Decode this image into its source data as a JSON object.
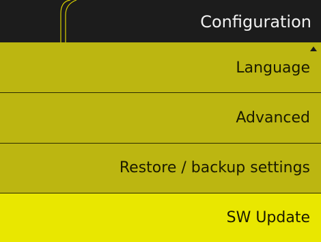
{
  "header": {
    "title": "Configuration"
  },
  "menu": {
    "items": [
      {
        "label": "Language",
        "selected": false
      },
      {
        "label": "Advanced",
        "selected": false
      },
      {
        "label": "Restore / backup settings",
        "selected": false
      },
      {
        "label": "SW Update",
        "selected": true
      }
    ],
    "scroll_indicator": "scroll-up-arrow-icon"
  },
  "colors": {
    "background": "#1c1c1c",
    "item": "#bcb611",
    "item_selected": "#e9e700",
    "header_text": "#f2f2f2",
    "item_text": "#1a1a00",
    "header_decor": "#d9d100"
  }
}
